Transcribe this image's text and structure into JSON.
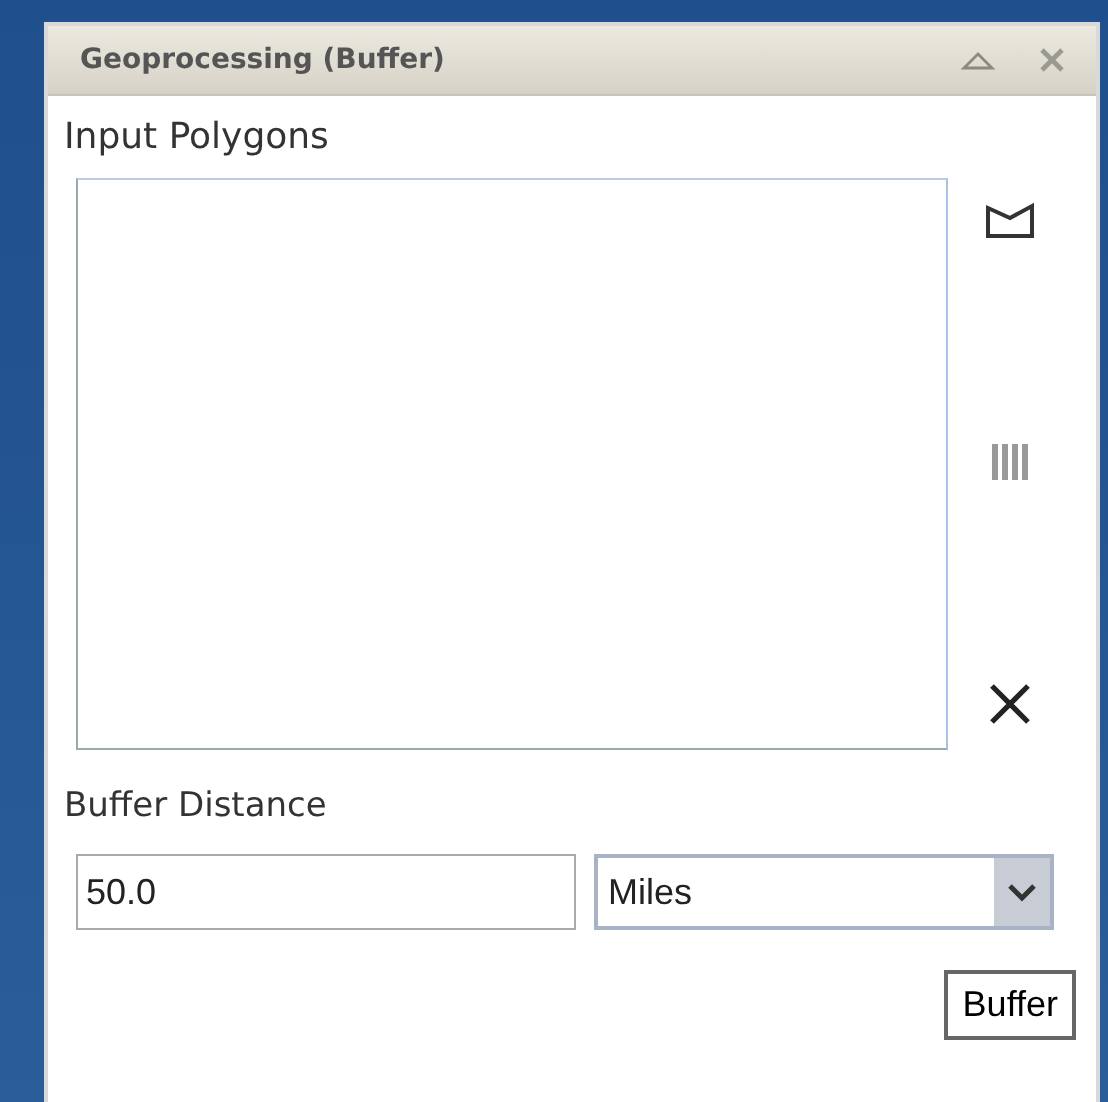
{
  "panel": {
    "title": "Geoprocessing (Buffer)"
  },
  "input_polygons": {
    "label": "Input Polygons"
  },
  "buffer_distance": {
    "label": "Buffer Distance",
    "value": "50.0",
    "units": "Miles"
  },
  "buttons": [
    "Buffer"
  ]
}
